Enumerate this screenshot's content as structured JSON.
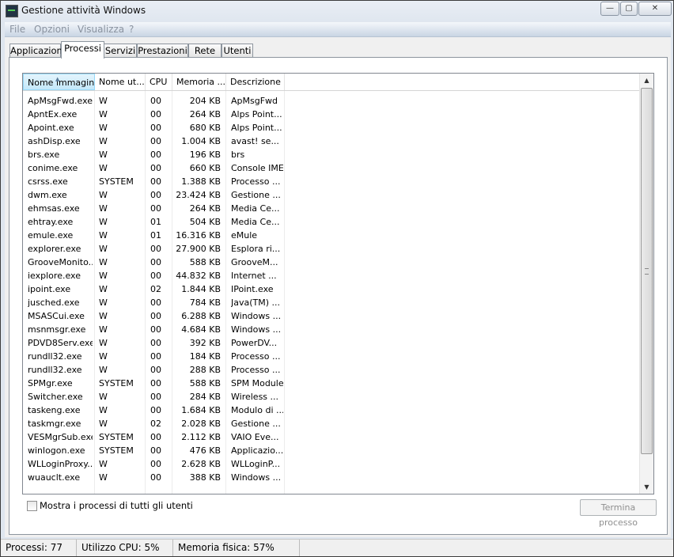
{
  "window": {
    "title": "Gestione attività Windows"
  },
  "title_buttons": {
    "minimize": "—",
    "maximize": "▢",
    "close": "✕"
  },
  "menu": [
    "File",
    "Opzioni",
    "Visualizza",
    "?"
  ],
  "tabs": [
    "Applicazioni",
    "Processi",
    "Servizi",
    "Prestazioni",
    "Rete",
    "Utenti"
  ],
  "active_tab": "Processi",
  "columns": [
    "Nome immagine",
    "Nome ut...",
    "CPU",
    "Memoria ...",
    "Descrizione"
  ],
  "processes": [
    {
      "name": "ApMsgFwd.exe",
      "user": "W",
      "cpu": "00",
      "mem": "204 KB",
      "desc": "ApMsgFwd"
    },
    {
      "name": "ApntEx.exe",
      "user": "W",
      "cpu": "00",
      "mem": "264 KB",
      "desc": "Alps Point..."
    },
    {
      "name": "Apoint.exe",
      "user": "W",
      "cpu": "00",
      "mem": "680 KB",
      "desc": "Alps Point..."
    },
    {
      "name": "ashDisp.exe",
      "user": "W",
      "cpu": "00",
      "mem": "1.004 KB",
      "desc": "avast! se..."
    },
    {
      "name": "brs.exe",
      "user": "W",
      "cpu": "00",
      "mem": "196 KB",
      "desc": "brs"
    },
    {
      "name": "conime.exe",
      "user": "W",
      "cpu": "00",
      "mem": "660 KB",
      "desc": "Console IME"
    },
    {
      "name": "csrss.exe",
      "user": "SYSTEM",
      "cpu": "00",
      "mem": "1.388 KB",
      "desc": "Processo ..."
    },
    {
      "name": "dwm.exe",
      "user": "W",
      "cpu": "00",
      "mem": "23.424 KB",
      "desc": "Gestione ..."
    },
    {
      "name": "ehmsas.exe",
      "user": "W",
      "cpu": "00",
      "mem": "264 KB",
      "desc": "Media Ce..."
    },
    {
      "name": "ehtray.exe",
      "user": "W",
      "cpu": "01",
      "mem": "504 KB",
      "desc": "Media Ce..."
    },
    {
      "name": "emule.exe",
      "user": "W",
      "cpu": "01",
      "mem": "16.316 KB",
      "desc": "eMule"
    },
    {
      "name": "explorer.exe",
      "user": "W",
      "cpu": "00",
      "mem": "27.900 KB",
      "desc": "Esplora ri..."
    },
    {
      "name": "GrooveMonito...",
      "user": "W",
      "cpu": "00",
      "mem": "588 KB",
      "desc": "GrooveM..."
    },
    {
      "name": "iexplore.exe",
      "user": "W",
      "cpu": "00",
      "mem": "44.832 KB",
      "desc": "Internet ..."
    },
    {
      "name": "ipoint.exe",
      "user": "W",
      "cpu": "02",
      "mem": "1.844 KB",
      "desc": "IPoint.exe"
    },
    {
      "name": "jusched.exe",
      "user": "W",
      "cpu": "00",
      "mem": "784 KB",
      "desc": "Java(TM) ..."
    },
    {
      "name": "MSASCui.exe",
      "user": "W",
      "cpu": "00",
      "mem": "6.288 KB",
      "desc": "Windows ..."
    },
    {
      "name": "msnmsgr.exe",
      "user": "W",
      "cpu": "00",
      "mem": "4.684 KB",
      "desc": "Windows ..."
    },
    {
      "name": "PDVD8Serv.exe",
      "user": "W",
      "cpu": "00",
      "mem": "392 KB",
      "desc": "PowerDV..."
    },
    {
      "name": "rundll32.exe",
      "user": "W",
      "cpu": "00",
      "mem": "184 KB",
      "desc": "Processo ..."
    },
    {
      "name": "rundll32.exe",
      "user": "W",
      "cpu": "00",
      "mem": "288 KB",
      "desc": "Processo ..."
    },
    {
      "name": "SPMgr.exe",
      "user": "SYSTEM",
      "cpu": "00",
      "mem": "588 KB",
      "desc": "SPM Module"
    },
    {
      "name": "Switcher.exe",
      "user": "W",
      "cpu": "00",
      "mem": "284 KB",
      "desc": "Wireless ..."
    },
    {
      "name": "taskeng.exe",
      "user": "W",
      "cpu": "00",
      "mem": "1.684 KB",
      "desc": "Modulo di ..."
    },
    {
      "name": "taskmgr.exe",
      "user": "W",
      "cpu": "02",
      "mem": "2.028 KB",
      "desc": "Gestione ..."
    },
    {
      "name": "VESMgrSub.exe",
      "user": "SYSTEM",
      "cpu": "00",
      "mem": "2.112 KB",
      "desc": "VAIO Eve..."
    },
    {
      "name": "winlogon.exe",
      "user": "SYSTEM",
      "cpu": "00",
      "mem": "476 KB",
      "desc": "Applicazio..."
    },
    {
      "name": "WLLoginProxy....",
      "user": "W",
      "cpu": "00",
      "mem": "2.628 KB",
      "desc": "WLLoginP..."
    },
    {
      "name": "wuauclt.exe",
      "user": "W",
      "cpu": "00",
      "mem": "388 KB",
      "desc": "Windows ..."
    }
  ],
  "show_all_label": "Mostra i processi di tutti gli utenti",
  "end_process_label": "Termina processo",
  "status": {
    "processes": "Processi: 77",
    "cpu": "Utilizzo CPU: 5%",
    "memory": "Memoria fisica: 57%"
  }
}
